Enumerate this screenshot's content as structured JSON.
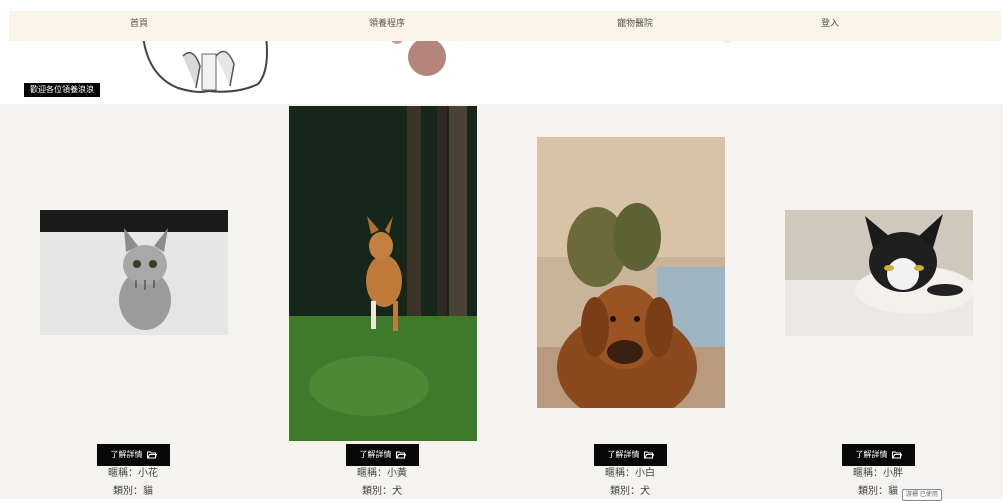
{
  "nav": {
    "items": [
      {
        "label": "首頁"
      },
      {
        "label": "領養程序"
      },
      {
        "label": "寵物醫院"
      },
      {
        "label": "登入"
      }
    ]
  },
  "hero": {
    "welcome_text": "歡迎各位領養浪浪"
  },
  "pets": [
    {
      "button_label": "了解詳情",
      "name_label": "暱稱：小花",
      "type_label": "類別：貓",
      "photo_icon": "cat-photo"
    },
    {
      "button_label": "了解詳情",
      "name_label": "暱稱：小黃",
      "type_label": "類別：犬",
      "photo_icon": "dog-photo"
    },
    {
      "button_label": "了解詳情",
      "name_label": "暱稱：小白",
      "type_label": "類別：犬",
      "photo_icon": "dog-photo"
    },
    {
      "button_label": "了解詳情",
      "name_label": "暱稱：小胖",
      "type_label": "類別：貓",
      "photo_icon": "cat-photo"
    }
  ],
  "tooltip": {
    "text": "游標 已使用"
  },
  "colors": {
    "nav_background": "#fbf4e9",
    "gallery_background": "#f4f3ef",
    "button_background": "#080808"
  }
}
